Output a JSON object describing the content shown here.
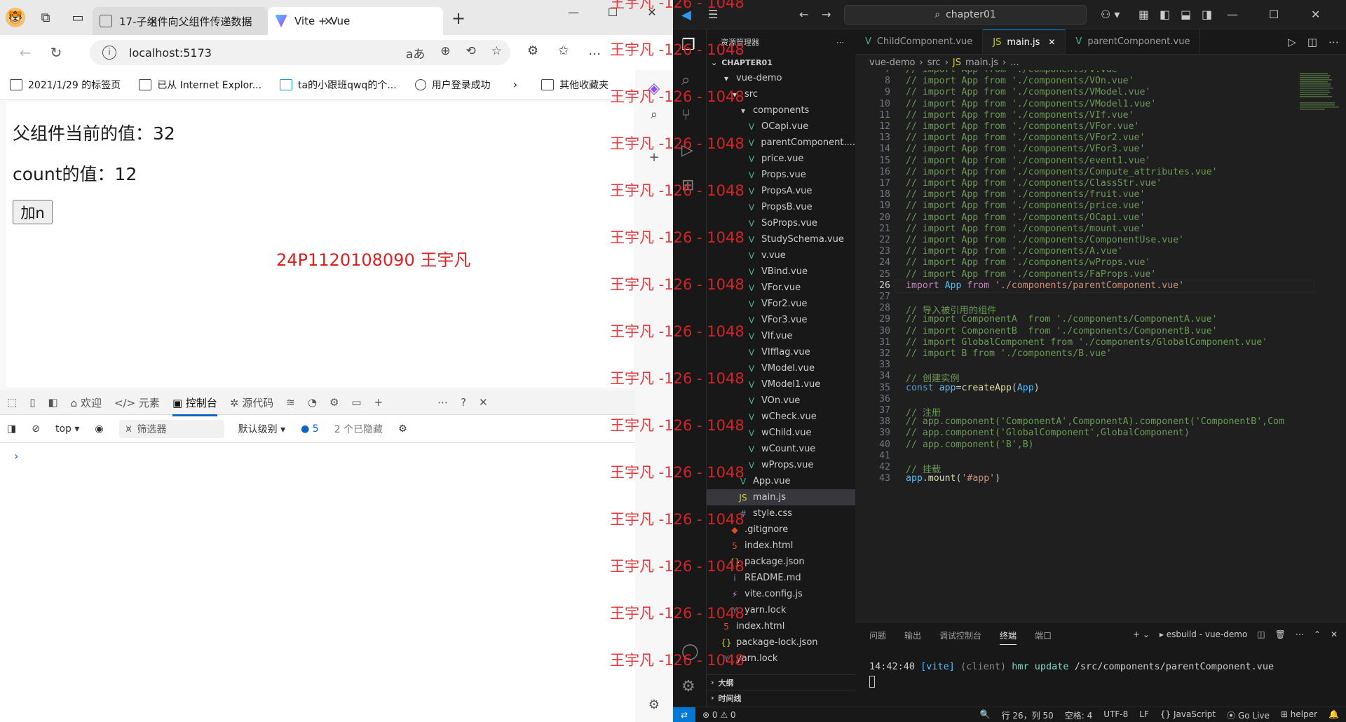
{
  "browser": {
    "tabs": [
      {
        "title": "17-子组件向父组件传递数据",
        "active": false
      },
      {
        "title": "Vite + Vue",
        "active": true
      }
    ],
    "url": "localhost:5173",
    "bookmarks": [
      "2021/1/29 的标签页",
      "已从 Internet Explor...",
      "ta的小跟班qwq的个...",
      "用户登录成功",
      "其他收藏夹"
    ],
    "page": {
      "parent_value_label": "父组件当前的值：32",
      "count_label": "count的值：12",
      "add_button": "加n",
      "signature": "24P1120108090 王宇凡"
    },
    "devtools": {
      "tabs": [
        "欢迎",
        "元素",
        "控制台",
        "源代码"
      ],
      "active_tab": "控制台",
      "context": "top",
      "filter_placeholder": "筛选器",
      "level": "默认级别",
      "issues_count": "5",
      "hidden": "2 个已隐藏",
      "prompt": "›"
    }
  },
  "watermark": "王宇凡 -126 - 1048",
  "vscode": {
    "search": "chapter01",
    "explorer_title": "资源管理器",
    "section": "CHAPTER01",
    "tree": [
      {
        "name": "vue-demo",
        "type": "folder",
        "indent": 1
      },
      {
        "name": "src",
        "type": "folder",
        "indent": 2
      },
      {
        "name": "components",
        "type": "folder",
        "indent": 3
      },
      {
        "name": "OCapi.vue",
        "type": "vue",
        "indent": 4
      },
      {
        "name": "parentComponent....",
        "type": "vue",
        "indent": 4
      },
      {
        "name": "price.vue",
        "type": "vue",
        "indent": 4
      },
      {
        "name": "Props.vue",
        "type": "vue",
        "indent": 4
      },
      {
        "name": "PropsA.vue",
        "type": "vue",
        "indent": 4
      },
      {
        "name": "PropsB.vue",
        "type": "vue",
        "indent": 4
      },
      {
        "name": "SoProps.vue",
        "type": "vue",
        "indent": 4
      },
      {
        "name": "StudySchema.vue",
        "type": "vue",
        "indent": 4
      },
      {
        "name": "v.vue",
        "type": "vue",
        "indent": 4
      },
      {
        "name": "VBind.vue",
        "type": "vue",
        "indent": 4
      },
      {
        "name": "VFor.vue",
        "type": "vue",
        "indent": 4
      },
      {
        "name": "VFor2.vue",
        "type": "vue",
        "indent": 4
      },
      {
        "name": "VFor3.vue",
        "type": "vue",
        "indent": 4
      },
      {
        "name": "VIf.vue",
        "type": "vue",
        "indent": 4
      },
      {
        "name": "VIfflag.vue",
        "type": "vue",
        "indent": 4
      },
      {
        "name": "VModel.vue",
        "type": "vue",
        "indent": 4
      },
      {
        "name": "VModel1.vue",
        "type": "vue",
        "indent": 4
      },
      {
        "name": "VOn.vue",
        "type": "vue",
        "indent": 4
      },
      {
        "name": "wCheck.vue",
        "type": "vue",
        "indent": 4
      },
      {
        "name": "wChild.vue",
        "type": "vue",
        "indent": 4
      },
      {
        "name": "wCount.vue",
        "type": "vue",
        "indent": 4
      },
      {
        "name": "wProps.vue",
        "type": "vue",
        "indent": 4
      },
      {
        "name": "App.vue",
        "type": "vue",
        "indent": 3
      },
      {
        "name": "main.js",
        "type": "js",
        "indent": 3,
        "selected": true
      },
      {
        "name": "style.css",
        "type": "css",
        "indent": 3
      },
      {
        "name": ".gitignore",
        "type": "git",
        "indent": 2
      },
      {
        "name": "index.html",
        "type": "html",
        "indent": 2
      },
      {
        "name": "package.json",
        "type": "json",
        "indent": 2
      },
      {
        "name": "README.md",
        "type": "md",
        "indent": 2
      },
      {
        "name": "vite.config.js",
        "type": "vite",
        "indent": 2
      },
      {
        "name": "yarn.lock",
        "type": "yarn",
        "indent": 2
      },
      {
        "name": "index.html",
        "type": "html",
        "indent": 1
      },
      {
        "name": "package-lock.json",
        "type": "json",
        "indent": 1
      },
      {
        "name": "yarn.lock",
        "type": "yarn",
        "indent": 1
      }
    ],
    "outline": "大纲",
    "timeline": "时间线",
    "editor_tabs": [
      {
        "name": "ChildComponent.vue",
        "type": "vue",
        "active": false
      },
      {
        "name": "main.js",
        "type": "js",
        "active": true
      },
      {
        "name": "parentComponent.vue",
        "type": "vue",
        "active": false
      }
    ],
    "breadcrumb": [
      "vue-demo",
      "src",
      "main.js",
      "..."
    ],
    "code": [
      {
        "n": "7",
        "t": "// import App from './components/v.vue'"
      },
      {
        "n": "8",
        "t": "// import App from './components/VOn.vue'"
      },
      {
        "n": "9",
        "t": "// import App from './components/VModel.vue'"
      },
      {
        "n": "10",
        "t": "// import App from './components/VModel1.vue'"
      },
      {
        "n": "11",
        "t": "// import App from './components/VIf.vue'"
      },
      {
        "n": "12",
        "t": "// import App from './components/VFor.vue'"
      },
      {
        "n": "13",
        "t": "// import App from './components/VFor2.vue'"
      },
      {
        "n": "14",
        "t": "// import App from './components/VFor3.vue'"
      },
      {
        "n": "15",
        "t": "// import App from './components/event1.vue'"
      },
      {
        "n": "16",
        "t": "// import App from './components/Compute_attributes.vue'"
      },
      {
        "n": "17",
        "t": "// import App from './components/ClassStr.vue'"
      },
      {
        "n": "18",
        "t": "// import App from './components/fruit.vue'"
      },
      {
        "n": "19",
        "t": "// import App from './components/price.vue'"
      },
      {
        "n": "20",
        "t": "// import App from './components/OCapi.vue'"
      },
      {
        "n": "21",
        "t": "// import App from './components/mount.vue'"
      },
      {
        "n": "22",
        "t": "// import App from './components/ComponentUse.vue'"
      },
      {
        "n": "23",
        "t": "// import App from './components/A.vue'"
      },
      {
        "n": "24",
        "t": "// import App from './components/wProps.vue'"
      },
      {
        "n": "25",
        "t": "// import App from './components/FaProps.vue'"
      },
      {
        "n": "26",
        "t": "import App from './components/parentComponent.vue'",
        "kind": "import"
      },
      {
        "n": "27",
        "t": ""
      },
      {
        "n": "28",
        "t": "// 导入被引用的组件"
      },
      {
        "n": "29",
        "t": "// import ComponentA  from './components/ComponentA.vue'"
      },
      {
        "n": "30",
        "t": "// import ComponentB  from './components/ComponentB.vue'"
      },
      {
        "n": "31",
        "t": "// import GlobalComponent from './components/GlobalComponent.vue'"
      },
      {
        "n": "32",
        "t": "// import B from './components/B.vue'"
      },
      {
        "n": "33",
        "t": ""
      },
      {
        "n": "34",
        "t": "// 创建实例"
      },
      {
        "n": "35",
        "t": "const app=createApp(App)",
        "kind": "const"
      },
      {
        "n": "36",
        "t": ""
      },
      {
        "n": "37",
        "t": "// 注册"
      },
      {
        "n": "38",
        "t": "// app.component('ComponentA',ComponentA).component('ComponentB',Com"
      },
      {
        "n": "39",
        "t": "// app.component('GlobalComponent',GlobalComponent)"
      },
      {
        "n": "40",
        "t": "// app.component('B',B)"
      },
      {
        "n": "41",
        "t": ""
      },
      {
        "n": "42",
        "t": "// 挂载"
      },
      {
        "n": "43",
        "t": "app.mount('#app')",
        "kind": "mount"
      }
    ],
    "panel_tabs": [
      "问题",
      "输出",
      "调试控制台",
      "终端",
      "端口"
    ],
    "panel_active": "终端",
    "terminal_name": "esbuild - vue-demo",
    "terminal": {
      "time": "14:42:40",
      "tag": "[vite]",
      "client": "(client)",
      "msg": "hmr update",
      "path": "/src/components/parentComponent.vue"
    },
    "status": {
      "errors": "0",
      "warnings": "0",
      "position": "行 26，列 50",
      "spaces": "空格: 4",
      "encoding": "UTF-8",
      "eol": "LF",
      "language": "JavaScript",
      "golive": "Go Live",
      "helper": "helper"
    }
  }
}
